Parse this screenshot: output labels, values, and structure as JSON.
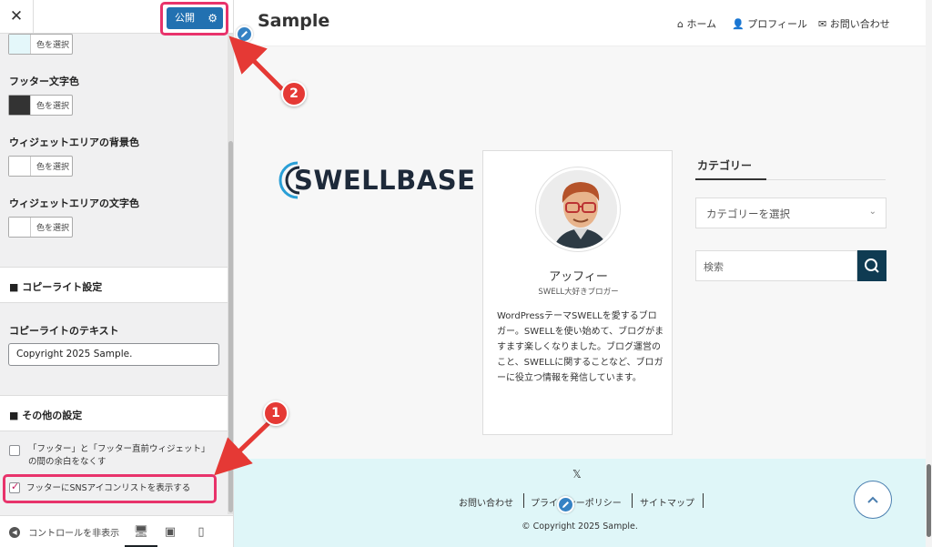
{
  "sidebar": {
    "close_glyph": "✕",
    "publish_label": "公開",
    "colors": [
      {
        "label": "",
        "swatch": "#e4f7fa",
        "button": "色を選択"
      },
      {
        "label": "フッター文字色",
        "swatch": "#333333",
        "button": "色を選択"
      },
      {
        "label": "ウィジェットエリアの背景色",
        "swatch": "#ffffff",
        "button": "色を選択"
      },
      {
        "label": "ウィジェットエリアの文字色",
        "swatch": "#ffffff",
        "button": "色を選択"
      }
    ],
    "copyright_section": "■ コピーライト設定",
    "copyright_label": "コピーライトのテキスト",
    "copyright_value": "Copyright 2025 Sample.",
    "other_section": "■ その他の設定",
    "option1_line1": "「フッター」と「フッター直前ウィジェット」",
    "option1_line2": "の間の余白をなくす",
    "option2": "フッターにSNSアイコンリストを表示する",
    "hide_controls": "コントロールを非表示"
  },
  "preview": {
    "site_title": "Sample",
    "nav": [
      "ホーム",
      "プロフィール",
      "お問い合わせ"
    ],
    "logo_text": "SWELLBASE",
    "profile": {
      "name": "アッフィー",
      "subtitle": "SWELL大好きブロガー",
      "description": "WordPressテーマSWELLを愛するブロガー。SWELLを使い始めて、ブログがますます楽しくなりました。ブログ運営のこと、SWELLに関することなど、ブロガーに役立つ情報を発信しています。"
    },
    "category_title": "カテゴリー",
    "category_select": "カテゴリーを選択",
    "search_placeholder": "検索",
    "footer_links": [
      "お問い合わせ",
      "プライバシーポリシー",
      "サイトマップ"
    ],
    "footer_copyright": "© Copyright 2025 Sample."
  },
  "annotations": [
    "1",
    "2"
  ],
  "colors": {
    "accent": "#2271b1",
    "highlight": "#e8336b",
    "badge": "#e53935",
    "footer_bg": "#dff6f8",
    "search_btn": "#0f3b52"
  }
}
